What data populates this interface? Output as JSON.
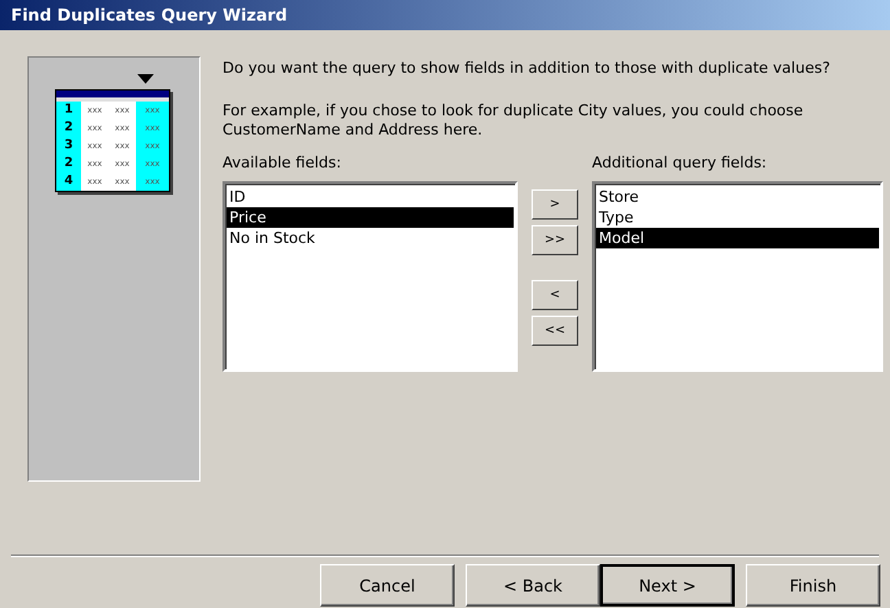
{
  "window": {
    "title": "Find Duplicates Query Wizard"
  },
  "illustration": {
    "rows": [
      {
        "number": "1",
        "cells": [
          "xxx",
          "xxx",
          "xxx"
        ]
      },
      {
        "number": "2",
        "cells": [
          "xxx",
          "xxx",
          "xxx"
        ]
      },
      {
        "number": "3",
        "cells": [
          "xxx",
          "xxx",
          "xxx"
        ]
      },
      {
        "number": "2",
        "cells": [
          "xxx",
          "xxx",
          "xxx"
        ]
      },
      {
        "number": "4",
        "cells": [
          "xxx",
          "xxx",
          "xxx"
        ]
      }
    ]
  },
  "question": "Do you want the query to show fields in addition to those with duplicate values?",
  "example": "For example, if you chose to look for duplicate City values, you could choose CustomerName and Address here.",
  "available": {
    "label": "Available fields:",
    "items": [
      {
        "label": "ID",
        "selected": false
      },
      {
        "label": "Price",
        "selected": true
      },
      {
        "label": "No in Stock",
        "selected": false
      }
    ]
  },
  "move_buttons": [
    ">",
    ">>",
    "<",
    "<<"
  ],
  "additional": {
    "label": "Additional query fields:",
    "items": [
      {
        "label": "Store",
        "selected": false
      },
      {
        "label": "Type",
        "selected": false
      },
      {
        "label": "Model",
        "selected": true
      }
    ]
  },
  "buttons": [
    {
      "label": "Cancel",
      "default": false
    },
    {
      "label": "< Back",
      "default": false
    },
    {
      "label": "Next >",
      "default": true
    },
    {
      "label": "Finish",
      "default": false
    }
  ]
}
